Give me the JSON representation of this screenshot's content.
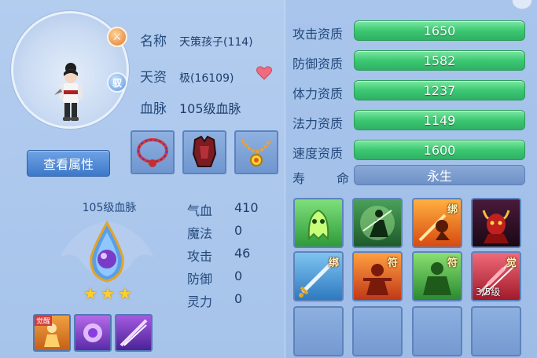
{
  "pet": {
    "name_label": "名称",
    "name_value": "天策孩子(114)",
    "aptitude_label": "天资",
    "aptitude_value": "极(16109)",
    "blood_label": "血脉",
    "blood_value": "105级血脉",
    "rank_badge": "⚔",
    "bind_badge": "驭"
  },
  "view_attr_button": "查看属性",
  "bloodline": {
    "title": "105级血脉",
    "stars": 3
  },
  "stats": [
    {
      "label": "气血",
      "value": "410"
    },
    {
      "label": "魔法",
      "value": "0"
    },
    {
      "label": "攻击",
      "value": "46"
    },
    {
      "label": "防御",
      "value": "0"
    },
    {
      "label": "灵力",
      "value": "0"
    }
  ],
  "aptitudes": [
    {
      "label": "攻击资质",
      "value": "1650"
    },
    {
      "label": "防御资质",
      "value": "1582"
    },
    {
      "label": "体力资质",
      "value": "1237"
    },
    {
      "label": "法力资质",
      "value": "1149"
    },
    {
      "label": "速度资质",
      "value": "1600"
    }
  ],
  "lifespan": {
    "label_a": "寿",
    "label_b": "命",
    "value": "永生"
  },
  "skill_tags": {
    "bind": "绑",
    "talisman": "符",
    "awaken": "觉",
    "awaken_level": "3/5级"
  },
  "small_skill_tag": "觉醒",
  "colors": {
    "aptitude_bar": "#3cc873",
    "button": "#3e78c9",
    "star": "#ffcf2e"
  }
}
